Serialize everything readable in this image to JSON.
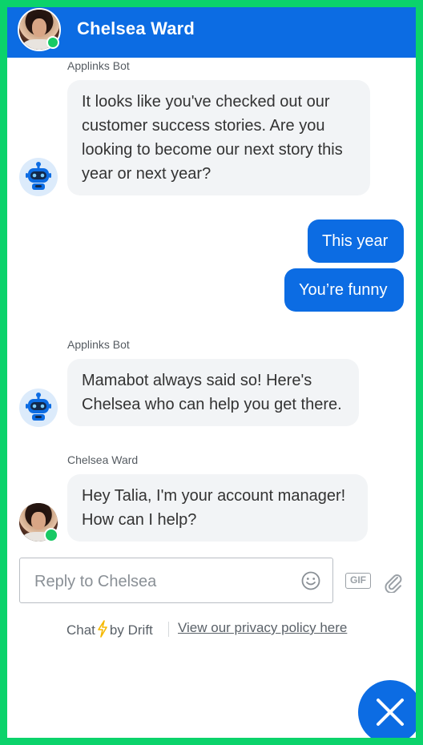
{
  "header": {
    "name": "Chelsea Ward"
  },
  "messages": {
    "m1": {
      "sender": "Applinks Bot",
      "lines": [
        "It looks like you've checked out our",
        "customer success stories. Are you",
        "looking to become our next story this",
        "year or next year?"
      ]
    },
    "r1": "This year",
    "r2": "You’re funny",
    "m2": {
      "sender": "Applinks Bot",
      "lines": [
        "Mamabot always said so! Here's",
        "Chelsea who can help you get there."
      ]
    },
    "m3": {
      "sender": "Chelsea Ward",
      "lines": [
        "Hey Talia, I'm your account manager!",
        "How can I help?"
      ]
    }
  },
  "composer": {
    "placeholder": "Reply to Chelsea",
    "gif_label": "GIF"
  },
  "footer": {
    "chat": "Chat",
    "by": "by Drift",
    "privacy": "View our privacy policy here"
  },
  "colors": {
    "brand": "#0c6ce3",
    "border": "#0bd36b",
    "online": "#17c964"
  },
  "icons": {
    "emoji": "smiley-icon",
    "attach": "paperclip-icon",
    "bolt": "lightning-icon",
    "close": "close-icon"
  }
}
